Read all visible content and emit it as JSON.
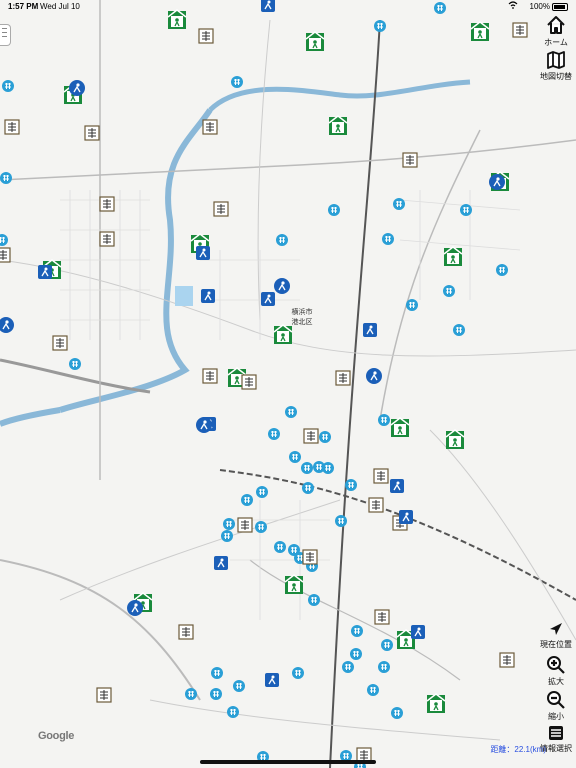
{
  "status": {
    "time": "1:57 PM",
    "date": "Wed Jul 10",
    "battery": "100%"
  },
  "map": {
    "labels": {
      "ward": "横浜市\n港北区"
    },
    "legend_colors": {
      "shelter": "#1a8a3c",
      "temple": "#2a9fd6",
      "storage": "#6b5a3a",
      "welfare": "#1b5fb8",
      "road": "#333333",
      "railway": "#777777",
      "river": "#8ab8d8"
    }
  },
  "controls": {
    "home": {
      "label": "ホーム",
      "icon": "home-icon"
    },
    "map_switch": {
      "label": "地図切替",
      "icon": "map-icon"
    },
    "current_location": {
      "label": "現在位置",
      "icon": "location-arrow-icon"
    },
    "zoom_in": {
      "label": "拡大",
      "icon": "zoom-in-icon"
    },
    "zoom_out": {
      "label": "縮小",
      "icon": "zoom-out-icon"
    },
    "info_select": {
      "label": "情報選択",
      "icon": "list-icon"
    }
  },
  "attribution": "Google",
  "distance": "距離：22.1(km)"
}
